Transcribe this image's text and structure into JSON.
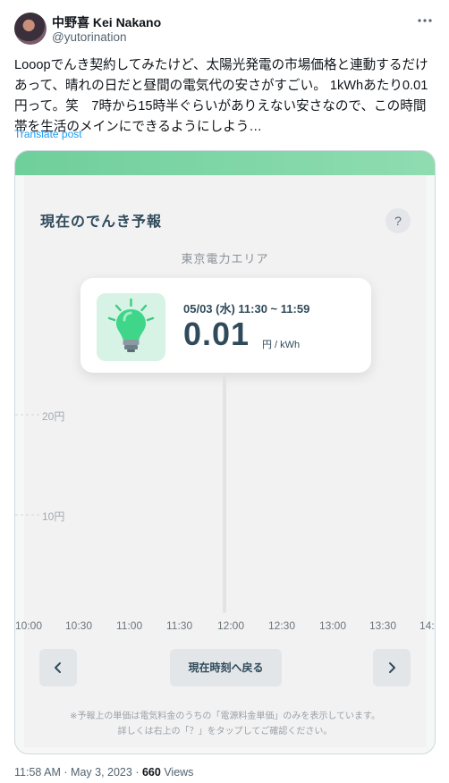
{
  "post": {
    "author_name": "中野喜 Kei Nakano",
    "handle": "@yutorination",
    "more_icon": "more-horizontal-icon",
    "text": "Looopでんき契約してみたけど、太陽光発電の市場価格と連動するだけあって、晴れの日だと昼間の電気代の安さがすごい。 1kWhあたり0.01円って。笑　7時から15時半ぐらいがありえない安さなので、この時間帯を生活のメインにできるようにしよう…",
    "translate_label": "Translate post",
    "time": "11:58 AM",
    "separator": "·",
    "date": "May 3, 2023",
    "views_count": "660",
    "views_label": "Views"
  },
  "app": {
    "accent": "#6fcf9b",
    "title": "現在のでんき予報",
    "help_label": "?",
    "area": "東京電力エリア",
    "card": {
      "datetime": "05/03 (水) 11:30 ~ 11:59",
      "price": "0.01",
      "unit": "円 / kWh",
      "icon": "lightbulb-icon"
    },
    "chart": {
      "y_ticks": [
        "20円",
        "10円"
      ],
      "x_ticks": [
        "10:00",
        "10:30",
        "11:00",
        "11:30",
        "12:00",
        "12:30",
        "13:00",
        "13:30",
        "14:"
      ]
    },
    "nav": {
      "prev_icon": "chevron-left-icon",
      "next_icon": "chevron-right-icon",
      "now_label": "現在時刻へ戻る"
    },
    "note_line1": "※予報上の単価は電気料金のうちの「電源料金単価」のみを表示しています。",
    "note_line2": "詳しくは右上の「？」をタップしてご確認ください。"
  }
}
